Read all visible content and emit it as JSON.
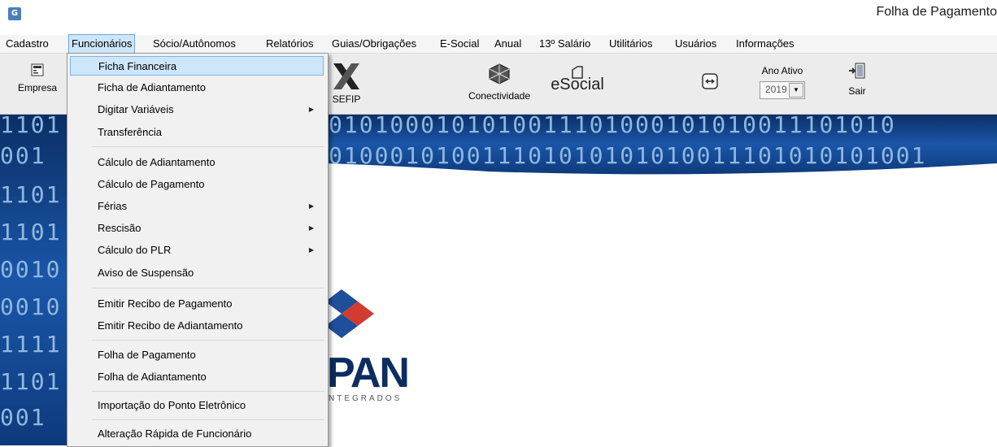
{
  "window": {
    "title": "Folha de Pagamento",
    "app_icon_glyph": "G"
  },
  "menubar": {
    "items": [
      {
        "label": "Cadastro"
      },
      {
        "label": "Funcionários"
      },
      {
        "label": "Sócio/Autônomos"
      },
      {
        "label": "Relatórios"
      },
      {
        "label": "Guias/Obrigações"
      },
      {
        "label": "E-Social"
      },
      {
        "label": "Anual"
      },
      {
        "label": "13º Salário"
      },
      {
        "label": "Utilitários"
      },
      {
        "label": "Usuários"
      },
      {
        "label": "Informações"
      }
    ],
    "active": "Funcionários"
  },
  "toolbar": {
    "empresa_label": "Empresa",
    "sefip_label": "SEFIP",
    "conectividade_label": "Conectividade",
    "esocial_logo": "eSocial",
    "ano_ativo_label": "Ano Ativo",
    "ano_ativo_value": "2019",
    "sair_label": "Sair"
  },
  "background": {
    "binary_rows": [
      "1101",
      "001",
      "1101",
      "1101",
      "0010",
      "0010",
      "1111",
      "1101",
      "001"
    ],
    "binary_right_rows": [
      "0101000101010011101000101010011101010",
      "010001010011101010101010011101010101001"
    ],
    "logo_text": "PAN",
    "logo_sub": "NTEGRADOS",
    "colors": {
      "binary_band": "#0d3a78",
      "logo_blue": "#1f4e9a",
      "logo_red": "#d23b30"
    }
  },
  "dropdown": {
    "items": [
      {
        "label": "Ficha Financeira",
        "submenu": false,
        "highlighted": true
      },
      {
        "label": "Ficha de Adiantamento",
        "submenu": false
      },
      {
        "label": "Digitar Variáveis",
        "submenu": true
      },
      {
        "label": "Transferência",
        "submenu": false
      },
      {
        "label": "Cálculo de Adiantamento",
        "submenu": false
      },
      {
        "label": "Cálculo de Pagamento",
        "submenu": false
      },
      {
        "label": "Férias",
        "submenu": true
      },
      {
        "label": "Rescisão",
        "submenu": true
      },
      {
        "label": "Cálculo do PLR",
        "submenu": true
      },
      {
        "label": "Aviso de Suspensão",
        "submenu": false
      },
      {
        "label": "Emitir Recibo de Pagamento",
        "submenu": false
      },
      {
        "label": "Emitir Recibo de Adiantamento",
        "submenu": false
      },
      {
        "label": "Folha de Pagamento",
        "submenu": false
      },
      {
        "label": "Folha de Adiantamento",
        "submenu": false
      },
      {
        "label": "Importação do Ponto Eletrônico",
        "submenu": false
      },
      {
        "label": "Alteração Rápida de Funcionário",
        "submenu": false
      }
    ],
    "submenu_arrow": "▶"
  }
}
